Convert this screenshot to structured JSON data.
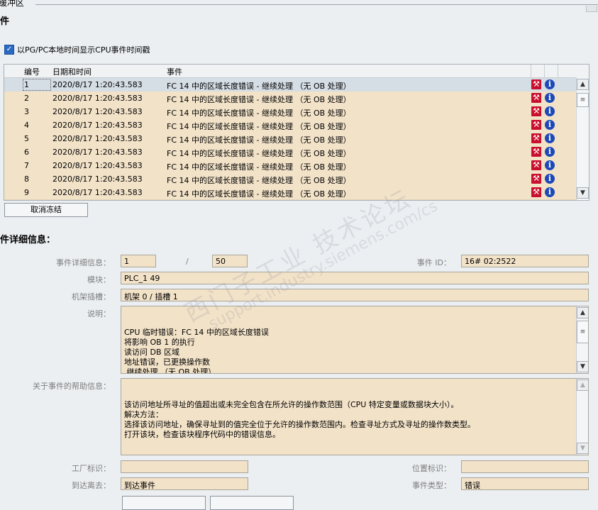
{
  "header": {
    "title_fragment": "缓冲区",
    "section_title": "件"
  },
  "options": {
    "local_time_label": "以PG/PC本地时间显示CPU事件时间戳"
  },
  "table": {
    "columns": [
      "编号",
      "日期和时间",
      "事件"
    ],
    "rows": [
      {
        "no": "1",
        "datetime": "2020/8/17 1:20:43.583",
        "event": "FC 14 中的区域长度错误 - 继续处理 （无 OB 处理）"
      },
      {
        "no": "2",
        "datetime": "2020/8/17 1:20:43.583",
        "event": "FC 14 中的区域长度错误 - 继续处理 （无 OB 处理）"
      },
      {
        "no": "3",
        "datetime": "2020/8/17 1:20:43.583",
        "event": "FC 14 中的区域长度错误 - 继续处理 （无 OB 处理）"
      },
      {
        "no": "4",
        "datetime": "2020/8/17 1:20:43.583",
        "event": "FC 14 中的区域长度错误 - 继续处理 （无 OB 处理）"
      },
      {
        "no": "5",
        "datetime": "2020/8/17 1:20:43.583",
        "event": "FC 14 中的区域长度错误 - 继续处理 （无 OB 处理）"
      },
      {
        "no": "6",
        "datetime": "2020/8/17 1:20:43.583",
        "event": "FC 14 中的区域长度错误 - 继续处理 （无 OB 处理）"
      },
      {
        "no": "7",
        "datetime": "2020/8/17 1:20:43.583",
        "event": "FC 14 中的区域长度错误 - 继续处理 （无 OB 处理）"
      },
      {
        "no": "8",
        "datetime": "2020/8/17 1:20:43.583",
        "event": "FC 14 中的区域长度错误 - 继续处理 （无 OB 处理）"
      },
      {
        "no": "9",
        "datetime": "2020/8/17 1:20:43.583",
        "event": "FC 14 中的区域长度错误 - 继续处理 （无 OB 处理）"
      }
    ],
    "row_icons": [
      "wrench-icon",
      "info-icon"
    ],
    "colors": {
      "row_bg": "#f2e2c8",
      "selected_bg": "#d5dde5",
      "wrench": "#c8102e",
      "info": "#1d49b8"
    }
  },
  "buttons": {
    "unfreeze": "取消冻结"
  },
  "details": {
    "title": "件详细信息：",
    "labels": {
      "event_detail": "事件详细信息：",
      "event_id": "事件 ID：",
      "module": "模块：",
      "rack_slot": "机架插槽：",
      "description": "说明：",
      "help": "关于事件的帮助信息：",
      "plant_id": "工厂标识：",
      "location_id": "位置标识：",
      "incoming_outgoing": "到达离去：",
      "event_type": "事件类型："
    },
    "values": {
      "current": "1",
      "separator": "/",
      "total": "50",
      "event_id": "16# 02:2522",
      "module": "PLC_1 49",
      "rack_slot": "机架 0 / 插槽 1",
      "description": "CPU 临时错误：FC 14 中的区域长度错误\n将影响 OB 1 的执行\n读访问 DB 区域\n地址错误，已更换操作数\n 继续处理 （无 OB 处理）",
      "help": "该访问地址所寻址的值超出或未完全包含在所允许的操作数范围（CPU 特定变量或数据块大小）。\n解决方法：\n选择该访问地址，确保寻址到的值完全位于允许的操作数范围内。检查寻址方式及寻址的操作数类型。\n打开该块，检查该块程序代码中的错误信息。",
      "plant_id": "",
      "location_id": "",
      "incoming_outgoing": "到达事件",
      "event_type": "错误"
    }
  },
  "watermark": {
    "line1": "西门子工业  技术论坛",
    "line2": "support.industry.siemens.com/cs"
  }
}
